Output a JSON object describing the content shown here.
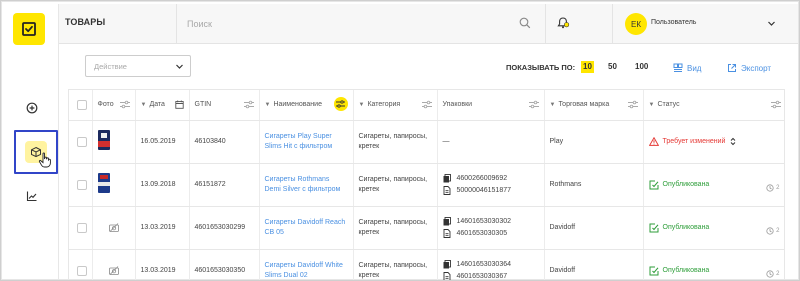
{
  "header": {
    "title": "ТОВАРЫ",
    "search_placeholder": "Поиск",
    "user_initials": "ЕК",
    "user_name": "Пользователь"
  },
  "sidebar": {
    "items": [
      {
        "name": "add",
        "icon": "plus-circle-icon"
      },
      {
        "name": "products",
        "icon": "box-icon",
        "active": true
      },
      {
        "name": "analytics",
        "icon": "chart-icon"
      }
    ]
  },
  "toolbar": {
    "action_placeholder": "Действие",
    "show_label": "ПОКАЗЫВАТЬ ПО:",
    "show_options": [
      "10",
      "50",
      "100"
    ],
    "show_selected": "10",
    "view_label": "Вид",
    "export_label": "Экспорт"
  },
  "table": {
    "columns": {
      "photo": "Фото",
      "date": "Дата",
      "gtin": "GTIN",
      "name": "Наименование",
      "category": "Категория",
      "packages": "Упаковки",
      "brand": "Торговая марка",
      "status": "Статус"
    },
    "rows": [
      {
        "date": "16.05.2019",
        "gtin": "46103840",
        "name": "Сигареты Play Super Slims Hit с фильтром",
        "category": "Сигареты, папиросы, кретек",
        "packages": [
          "—"
        ],
        "brand": "Play",
        "status": "Требует изменений",
        "status_type": "warn",
        "history": "",
        "photo": "red"
      },
      {
        "date": "13.09.2018",
        "gtin": "46151872",
        "name": "Сигареты Rothmans Demi Silver с фильтром",
        "category": "Сигареты, папиросы, кретек",
        "packages": [
          "4600266009692",
          "50000046151877"
        ],
        "brand": "Rothmans",
        "status": "Опубликована",
        "status_type": "ok",
        "history": "2",
        "photo": "blue"
      },
      {
        "date": "13.03.2019",
        "gtin": "4601653030299",
        "name": "Сигареты Davidoff Reach CB 05",
        "category": "Сигареты, папиросы, кретек",
        "packages": [
          "14601653030302",
          "4601653030305"
        ],
        "brand": "Davidoff",
        "status": "Опубликована",
        "status_type": "ok",
        "history": "2",
        "photo": "none"
      },
      {
        "date": "13.03.2019",
        "gtin": "4601653030350",
        "name": "Сигареты Davidoff White Slims Dual 02",
        "category": "Сигареты, папиросы, кретек",
        "packages": [
          "14601653030364",
          "4601653030367"
        ],
        "brand": "Davidoff",
        "status": "Опубликована",
        "status_type": "ok",
        "history": "2",
        "photo": "none"
      }
    ]
  },
  "colors": {
    "accent": "#ffe600",
    "link": "#4a90e2",
    "warn": "#e53935",
    "ok": "#2e9e3a",
    "focus": "#3145c8"
  }
}
